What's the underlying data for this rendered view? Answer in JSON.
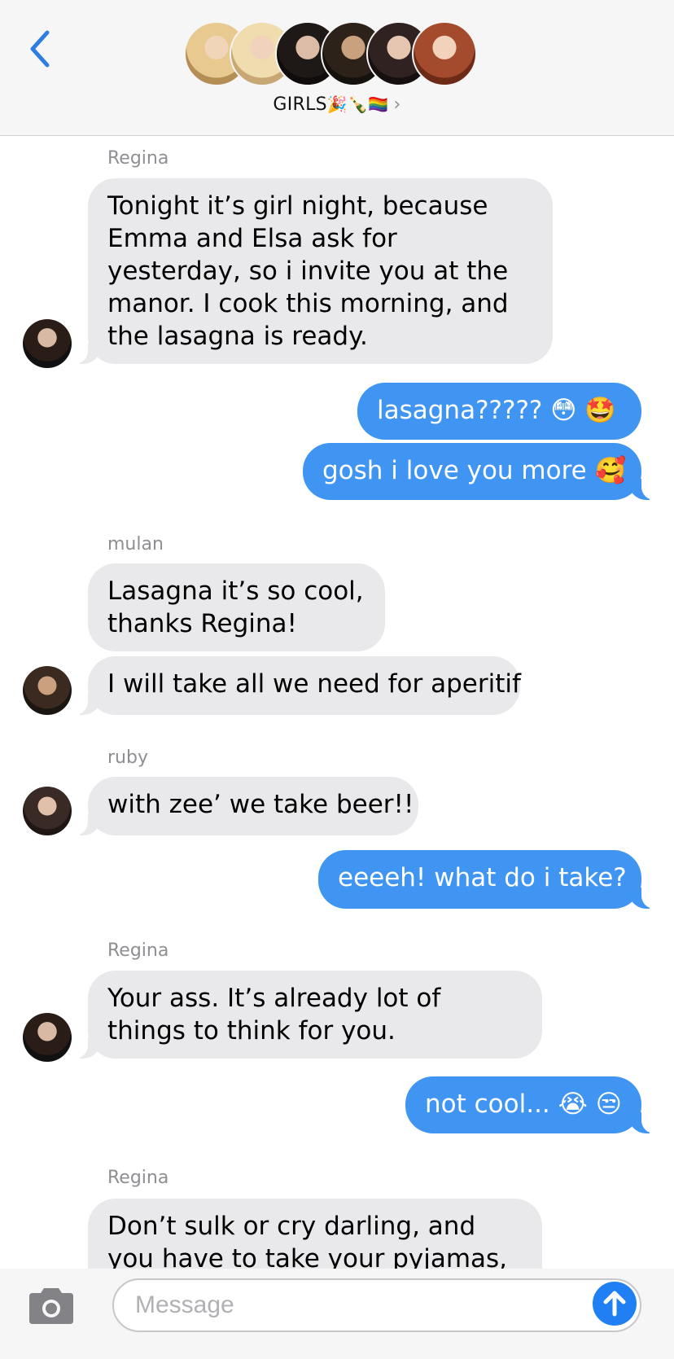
{
  "header": {
    "group_name": "GIRLS",
    "title_emojis": "🎉🍾🏳️‍🌈",
    "chevron": "›",
    "back_icon": "chevron-left-icon",
    "avatar_count": 6
  },
  "messages": [
    {
      "sender": "Regina"
    },
    {
      "text": "Tonight it’s girl night, because Emma and Elsa ask for yesterday, so i invite you at the manor. I cook this morning, and the lasagna is ready."
    },
    {
      "text": "lasagna????? 😳 🤩"
    },
    {
      "text": "gosh i love you more 🥰"
    },
    {
      "sender": "mulan"
    },
    {
      "text": "Lasagna it’s so cool, thanks Regina!"
    },
    {
      "text": "I will take all we need for aperitif"
    },
    {
      "sender": "ruby"
    },
    {
      "text": "with zee’ we take beer!!"
    },
    {
      "text": "eeeeh! what do i take?"
    },
    {
      "sender": "Regina"
    },
    {
      "text": "Your ass. It’s already lot of things to think for you."
    },
    {
      "text": "not cool... 😭 😒"
    },
    {
      "sender": "Regina"
    },
    {
      "text": "Don’t sulk or cry darling, and you have to take your pyjamas, and"
    }
  ],
  "composer": {
    "placeholder": "Message",
    "camera_icon": "camera-icon",
    "send_icon": "arrow-up-icon"
  },
  "colors": {
    "outgoing": "#3f95f1",
    "incoming": "#e9e9eb",
    "accent": "#1f7ff3"
  }
}
